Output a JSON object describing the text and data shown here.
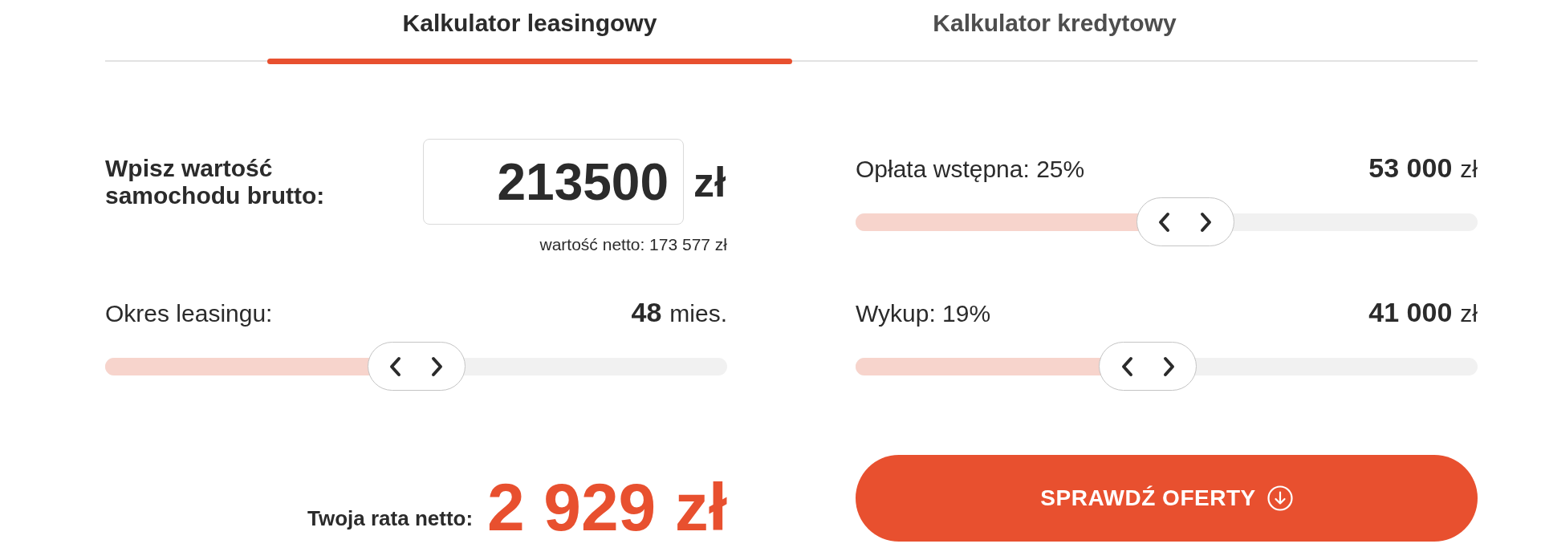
{
  "tabs": [
    {
      "label": "Kalkulator leasingowy",
      "selected": true
    },
    {
      "label": "Kalkulator kredytowy",
      "selected": false
    }
  ],
  "left_panel": {
    "price_input": {
      "label": "Wpisz wartość samochodu brutto:",
      "value": "213500",
      "unit": "zł",
      "note": "wartość netto: 173 577 zł"
    },
    "sliders": [
      {
        "label": "Okres leasingu:",
        "value": "48",
        "unit": "mies.",
        "level": 0.5
      }
    ],
    "result": {
      "label": "Twoja rata netto:",
      "amount": "2 929 zł"
    }
  },
  "right_panel": {
    "sliders": [
      {
        "label": "Opłata wstępna: 25%",
        "value": "53 000",
        "unit": "zł",
        "level": 0.53
      },
      {
        "label": "Wykup: 19%",
        "value": "41 000",
        "unit": "zł",
        "level": 0.47
      }
    ],
    "button": {
      "label": "SPRAWDŹ OFERTY"
    }
  }
}
